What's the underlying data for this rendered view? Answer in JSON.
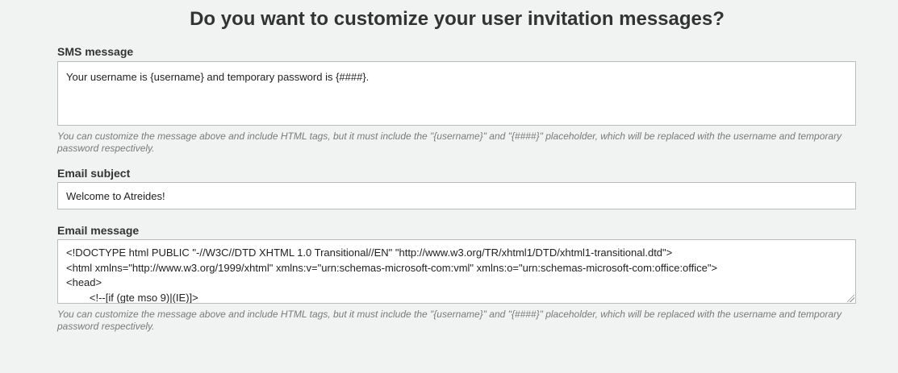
{
  "page": {
    "title": "Do you want to customize your user invitation messages?"
  },
  "sms": {
    "label": "SMS message",
    "value": "Your username is {username} and temporary password is {####}.",
    "help": "You can customize the message above and include HTML tags, but it must include the \"{username}\" and \"{####}\" placeholder, which will be replaced with the username and temporary password respectively."
  },
  "email_subject": {
    "label": "Email subject",
    "value": "Welcome to Atreides!"
  },
  "email_message": {
    "label": "Email message",
    "lines": [
      "<!DOCTYPE html PUBLIC \"-//W3C//DTD XHTML 1.0 Transitional//EN\" \"http://www.w3.org/TR/xhtml1/DTD/xhtml1-transitional.dtd\">",
      "<html xmlns=\"http://www.w3.org/1999/xhtml\" xmlns:v=\"urn:schemas-microsoft-com:vml\" xmlns:o=\"urn:schemas-microsoft-com:office:office\">",
      "<head>",
      "        <!--[if (gte mso 9)|(IE)]>"
    ],
    "help": "You can customize the message above and include HTML tags, but it must include the \"{username}\" and \"{####}\" placeholder, which will be replaced with the username and temporary password respectively."
  }
}
